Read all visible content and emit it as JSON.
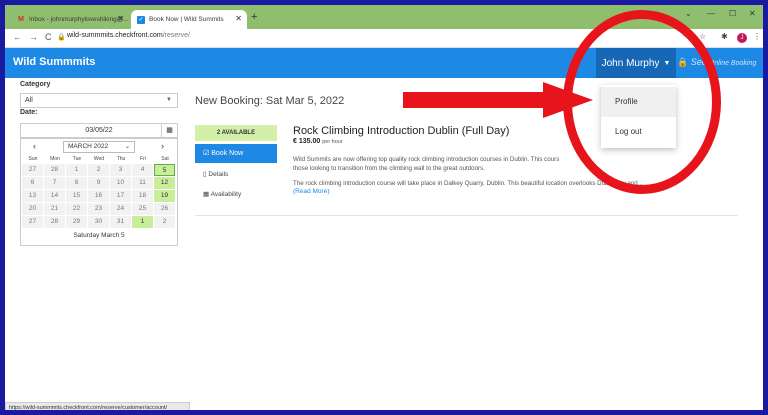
{
  "browser": {
    "tabs": [
      {
        "title": "Inbox - johnmurphyloveshiking@...",
        "icon": "gmail-icon"
      },
      {
        "title": "Book Now | Wild Summits",
        "icon": "checkfront-icon"
      }
    ],
    "url_host": "wild-summmits.checkfront.com",
    "url_path": "/reserve/",
    "profile_initial": "J"
  },
  "header": {
    "brand": "Wild Summmits",
    "user_name": "John Murphy",
    "signin_label": "Sec",
    "signin_sub": "Online Booking"
  },
  "dropdown": {
    "items": [
      "Profile",
      "Log out"
    ]
  },
  "sidebar": {
    "category_label": "Category",
    "category_value": "All",
    "date_label": "Date:",
    "date_value": "03/05/22",
    "month_value": "MARCH 2022",
    "weekdays": [
      "Sun",
      "Mon",
      "Tue",
      "Wed",
      "Thu",
      "Fri",
      "Sat"
    ],
    "weeks": [
      [
        "27",
        "28",
        "1",
        "2",
        "3",
        "4",
        "5"
      ],
      [
        "6",
        "7",
        "8",
        "9",
        "10",
        "11",
        "12"
      ],
      [
        "13",
        "14",
        "15",
        "16",
        "17",
        "18",
        "19"
      ],
      [
        "20",
        "21",
        "22",
        "23",
        "24",
        "25",
        "26"
      ],
      [
        "27",
        "28",
        "29",
        "30",
        "31",
        "1",
        "2"
      ]
    ],
    "available_days": [
      "5",
      "12",
      "19",
      "1"
    ],
    "selected_day": "5",
    "footer": "Saturday March 5"
  },
  "main": {
    "title": "New Booking: Sat Mar 5, 2022",
    "badge": "2 AVAILABLE",
    "book_now": "Book Now",
    "details": "Details",
    "availability": "Availability",
    "product_title": "Rock Climbing Introduction Dublin (Full Day)",
    "price": "€ 135.00",
    "price_unit": "per hour",
    "desc1": "Wild Summits are now offering top quality rock climbing introduction courses in Dublin. This cours",
    "desc1b": "those looking to transition from the climbing wall to the great outdoors.",
    "desc2": "The rock climbing introduction course will take place in Dalkey Quarry, Dublin. This beautiful location overlooks Dublin city and...",
    "read_more": "(Read More)"
  },
  "status_url": "https://wild-summmits.checkfront.com/reserve/customer/account/",
  "colors": {
    "accent": "#1e88e5",
    "tabstrip": "#8fbe6f",
    "available": "#c9ee9a",
    "annotation": "#e8141b",
    "frame": "#1a1aa0"
  }
}
